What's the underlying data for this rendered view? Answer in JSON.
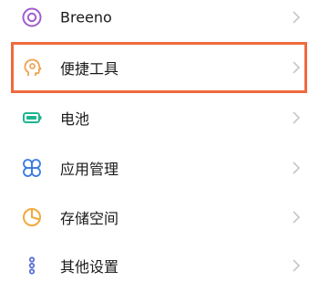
{
  "settings": {
    "items": [
      {
        "label": "Breeno",
        "icon": "breeno-icon"
      },
      {
        "label": "便捷工具",
        "icon": "convenience-tools-icon"
      },
      {
        "label": "电池",
        "icon": "battery-icon"
      },
      {
        "label": "应用管理",
        "icon": "app-management-icon"
      },
      {
        "label": "存储空间",
        "icon": "storage-icon"
      },
      {
        "label": "其他设置",
        "icon": "other-settings-icon"
      }
    ]
  },
  "colors": {
    "highlight_border": "#f06a3c",
    "breeno": "#a15bd0",
    "convenience": "#f0a04b",
    "battery": "#1fb58f",
    "apps": "#3b7ddd",
    "storage": "#f2a93b",
    "other": "#5b6fd6",
    "chevron": "#c7c7c7"
  }
}
